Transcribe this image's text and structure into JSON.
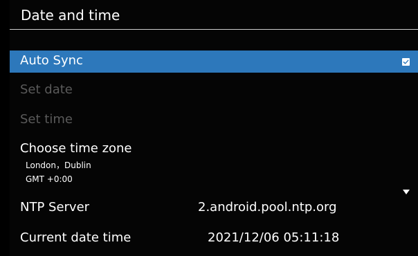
{
  "screen": {
    "title": "Date and time"
  },
  "menu": {
    "auto_sync": {
      "label": "Auto Sync",
      "checked": true
    },
    "set_date": {
      "label": "Set date",
      "enabled": false
    },
    "set_time": {
      "label": "Set time",
      "enabled": false
    },
    "time_zone": {
      "label": "Choose time zone",
      "city": "London，Dublin",
      "offset": "GMT +0:00"
    },
    "ntp_server": {
      "label": "NTP Server",
      "value": "2.android.pool.ntp.org"
    },
    "current_datetime": {
      "label": "Current date time",
      "value": "2021/12/06 05:11:18"
    }
  },
  "scroll": {
    "more_below_icon": "triangle-down-icon"
  },
  "colors": {
    "background": "#000000",
    "selection": "#2d78bb",
    "text": "#ffffff",
    "disabled_text": "#5a5a5a",
    "divider": "#cfcfcf"
  }
}
